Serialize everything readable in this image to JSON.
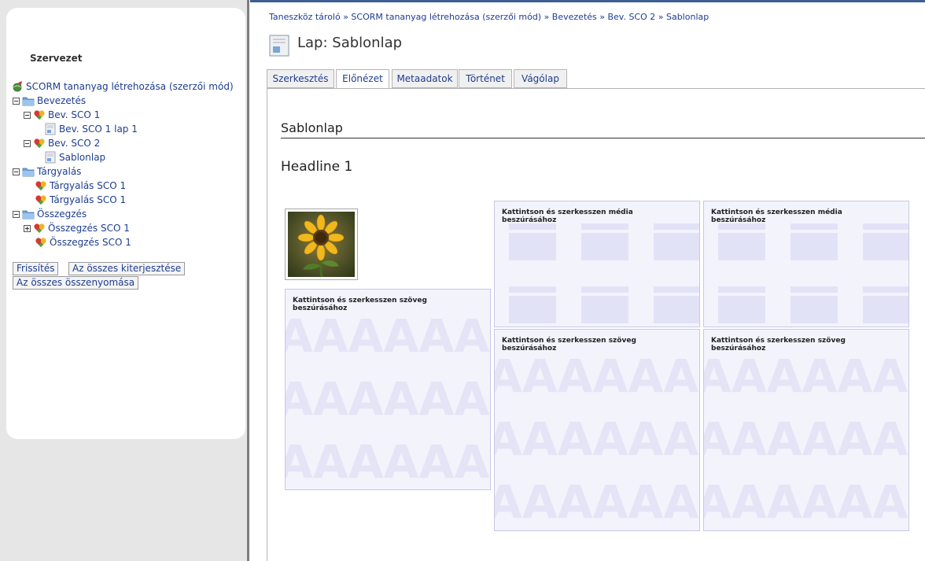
{
  "sidebar": {
    "title": "Szervezet",
    "tree": [
      {
        "label": "SCORM tananyag létrehozása (szerzői mód)"
      },
      {
        "label": "Bevezetés"
      },
      {
        "label": "Bev. SCO 1"
      },
      {
        "label": "Bev. SCO 1 lap 1"
      },
      {
        "label": "Bev. SCO 2"
      },
      {
        "label": "Sablonlap"
      },
      {
        "label": "Tárgyalás"
      },
      {
        "label": "Tárgyalás SCO 1"
      },
      {
        "label": "Tárgyalás SCO 1"
      },
      {
        "label": "Összegzés"
      },
      {
        "label": "Összegzés SCO 1"
      },
      {
        "label": "Összegzés SCO 1"
      }
    ],
    "buttons": {
      "refresh": "Frissítés",
      "expand_all": "Az összes kiterjesztése",
      "collapse_all": "Az összes összenyomása"
    }
  },
  "main": {
    "breadcrumb": "Taneszköz tároló » SCORM tananyag létrehozása (szerzői mód) » Bevezetés » Bev. SCO 2 » Sablonlap",
    "page_title": "Lap: Sablonlap",
    "tabs": [
      "Szerkesztés",
      "Előnézet",
      "Metaadatok",
      "Történet",
      "Vágólap"
    ],
    "active_tab": "Előnézet",
    "content": {
      "section_title": "Sablonlap",
      "headline": "Headline 1",
      "placeholders": {
        "media": "Kattintson és szerkesszen média beszúrásához",
        "text": "Kattintson és szerkesszen szöveg beszúrásához"
      }
    }
  },
  "colors": {
    "link": "#1e3d8f",
    "sidebar_bg": "#e6e6e6",
    "placeholder_bg": "#f3f3fc",
    "top_rule": "#3d5f94"
  },
  "icons": [
    "scorm-package-icon",
    "folder-icon",
    "sco-heart-icon",
    "page-icon",
    "tree-collapse-icon",
    "tree-expand-icon",
    "sunflower-image"
  ]
}
